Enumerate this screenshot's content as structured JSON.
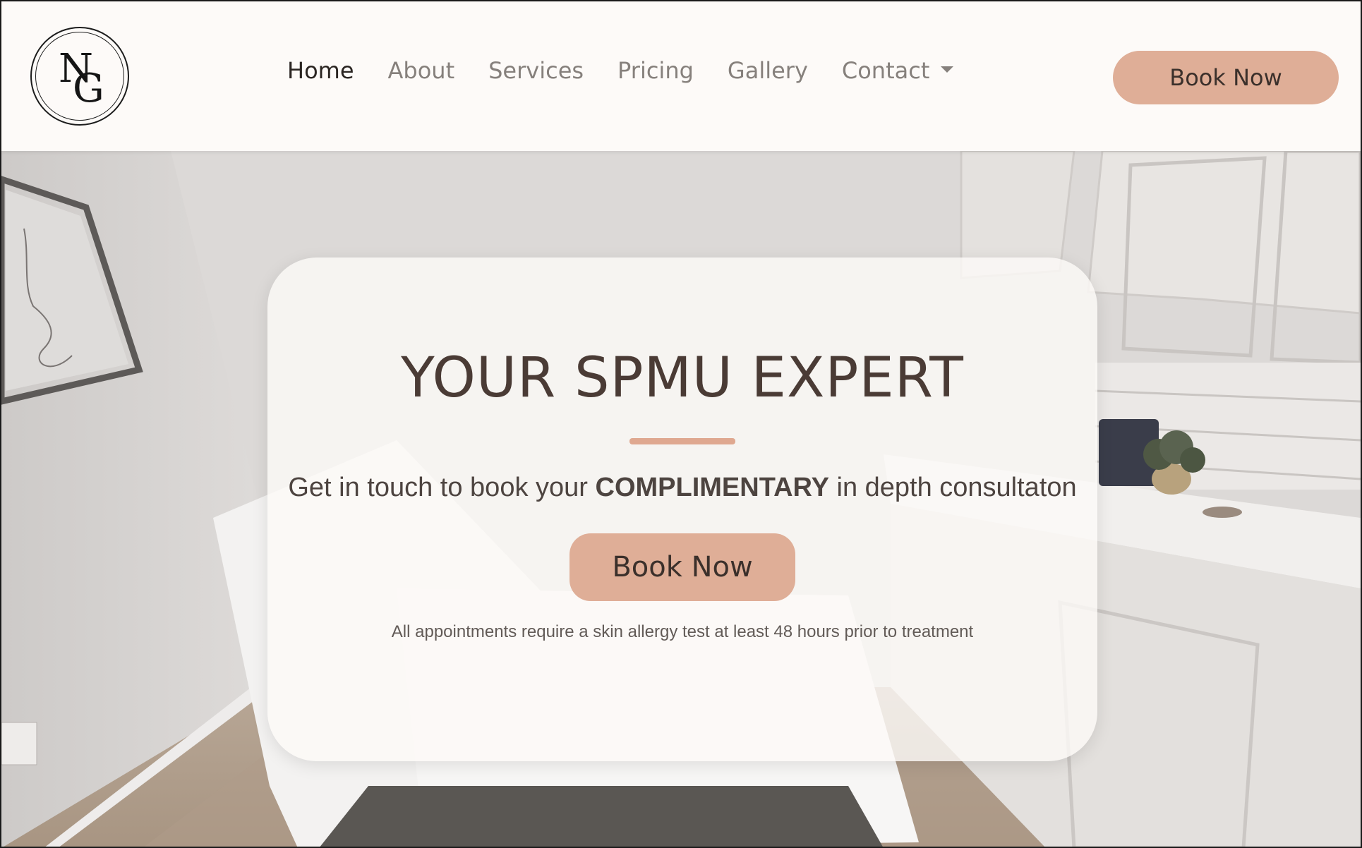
{
  "header": {
    "logo_text": "NG",
    "nav": [
      {
        "label": "Home",
        "active": true
      },
      {
        "label": "About",
        "active": false
      },
      {
        "label": "Services",
        "active": false
      },
      {
        "label": "Pricing",
        "active": false
      },
      {
        "label": "Gallery",
        "active": false
      },
      {
        "label": "Contact",
        "active": false,
        "has_dropdown": true
      }
    ],
    "cta_label": "Book Now"
  },
  "hero": {
    "title": "YOUR SPMU EXPERT",
    "subtitle_before": "Get in touch to book your ",
    "subtitle_bold": "COMPLIMENTARY",
    "subtitle_after": " in depth consultaton",
    "cta_label": "Book Now",
    "note": "All appointments require a skin allergy test at least 48 hours prior to treatment"
  },
  "colors": {
    "accent": "#dfae97",
    "header_bg": "#fdfaf8",
    "title": "#4a3b35",
    "nav_active": "#2b2522",
    "nav_inactive": "#86807c"
  },
  "icons": {
    "nav_dropdown": "caret-down-icon"
  }
}
